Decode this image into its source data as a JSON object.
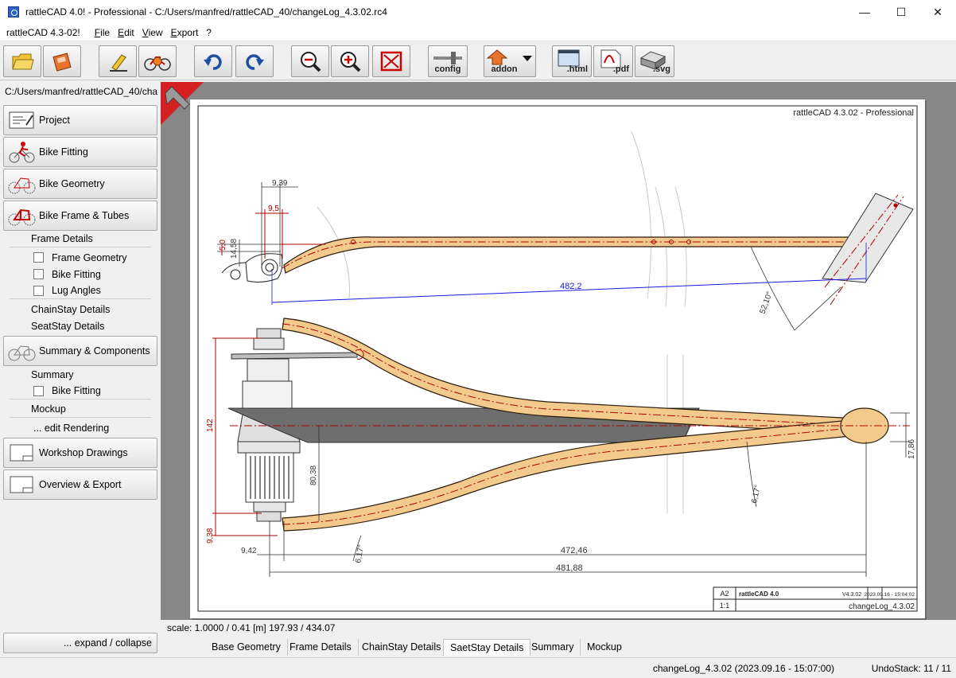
{
  "window": {
    "title": "rattleCAD 4.0! - Professional  - C:/Users/manfred/rattleCAD_40/changeLog_4.3.02.rc4",
    "minimize": "—",
    "maximize": "☐",
    "close": "✕"
  },
  "menubar": {
    "version": "rattleCAD 4.3-02!",
    "items": [
      "File",
      "Edit",
      "View",
      "Export",
      "?"
    ]
  },
  "toolbar": {
    "config_label": "config",
    "addon_label": "addon",
    "html_label": ".html",
    "pdf_label": ".pdf",
    "svg_label": ".svg",
    "icons": [
      "open-folder-icon",
      "save-icon",
      "edit-pencil-icon",
      "bike-render-icon",
      "undo-icon",
      "redo-icon",
      "zoom-out-icon",
      "zoom-in-icon",
      "fit-to-window-icon",
      "config-icon",
      "addon-icon",
      "html-export-icon",
      "pdf-export-icon",
      "svg-export-icon"
    ]
  },
  "path": "C:/Users/manfred/rattleCAD_40/changeLog_4.3.02.rc4",
  "sidebar": {
    "nav": [
      {
        "label": "Project",
        "icon": "project-icon"
      },
      {
        "label": "Bike Fitting",
        "icon": "bike-fitting-icon"
      },
      {
        "label": "Bike Geometry",
        "icon": "bike-geometry-icon"
      },
      {
        "label": "Bike Frame & Tubes",
        "icon": "bike-frame-icon"
      },
      {
        "label": "Summary & Components",
        "icon": "summary-icon"
      },
      {
        "label": "Workshop Drawings",
        "icon": "workshop-drawings-icon"
      },
      {
        "label": "Overview & Export",
        "icon": "overview-export-icon"
      }
    ],
    "frame_details": "Frame Details",
    "frame_items": [
      "Frame Geometry",
      "Bike Fitting",
      "Lug Angles"
    ],
    "chainstay_details": "ChainStay Details",
    "seatstay_details": "SeatStay Details",
    "summary": "Summary",
    "summary_items": [
      "Bike Fitting"
    ],
    "mockup": "Mockup",
    "edit_rendering": "... edit Rendering",
    "expand_collapse": "... expand / collapse"
  },
  "drawing": {
    "header": "rattleCAD  4.3.02  -  Professional",
    "dims": {
      "d939": "9,39",
      "d95": "9,5",
      "d5": "5,0",
      "d1458": "14,58",
      "d4822": "482,2",
      "a5210": "52,10°",
      "d142": "142",
      "d8038": "80,38",
      "d938": "9,38",
      "d942": "9,42",
      "a617a": "6,17°",
      "d47246": "472,46",
      "d48188": "481,88",
      "a617b": "6,17°",
      "d1786": "17,86"
    },
    "titleblock": {
      "format": "A2",
      "brand": "rattleCAD 4.0",
      "version": "V4.3.02",
      "datetime": "2023.09.16 - 15:04:02",
      "scale": "1:1",
      "file": "changeLog_4.3.02"
    },
    "colors": {
      "tube": "#f2cb8c",
      "dimension_black": "#333333",
      "dimension_red": "#b00000",
      "dimension_blue": "#1a1ae6",
      "hub_grey": "#6e6e6e"
    }
  },
  "scale_text": "scale: 1.0000 / 0.41  [m]  197.93 / 434.07",
  "tabs": [
    "Base Geometry",
    "Frame Details",
    "ChainStay Details",
    "SaetStay Details",
    "Summary",
    "Mockup"
  ],
  "active_tab": "SaetStay Details",
  "status": {
    "file": "changeLog_4.3.02 (2023.09.16 - 15:07:00)",
    "undo": "UndoStack: 11 / 11"
  }
}
